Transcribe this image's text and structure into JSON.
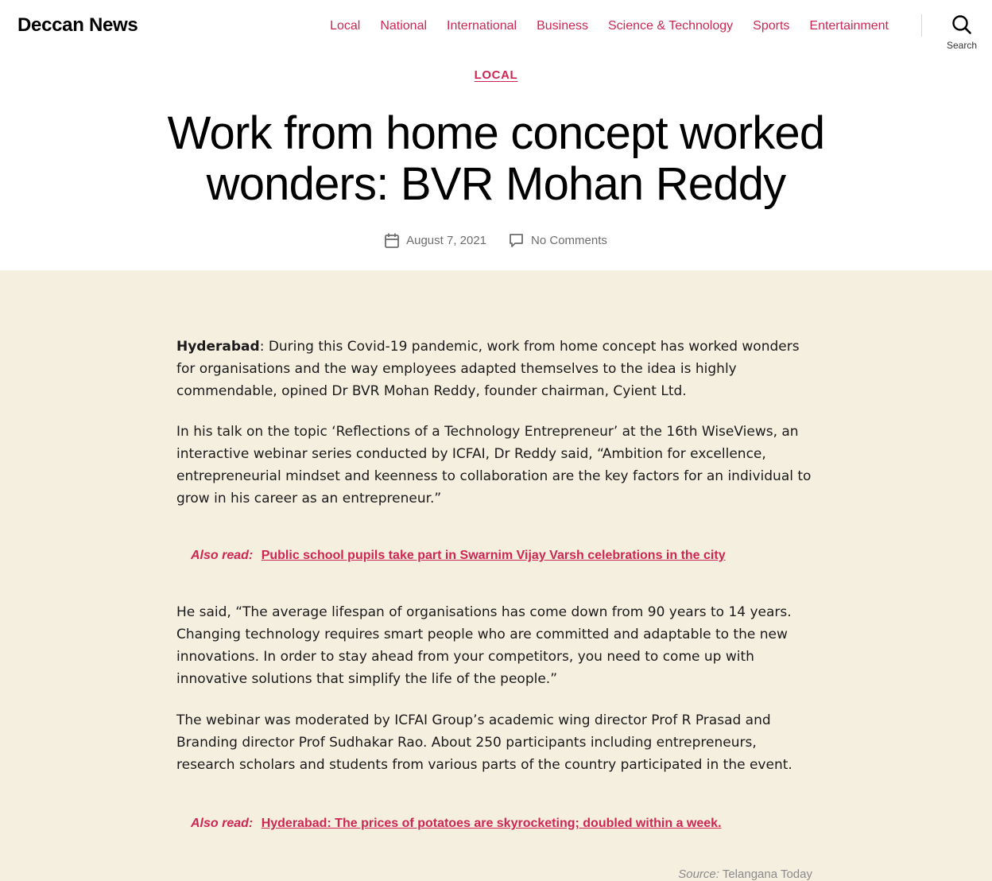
{
  "header": {
    "site_title": "Deccan News",
    "nav": [
      {
        "label": "Local"
      },
      {
        "label": "National"
      },
      {
        "label": "International"
      },
      {
        "label": "Business"
      },
      {
        "label": "Science & Technology"
      },
      {
        "label": "Sports"
      },
      {
        "label": "Entertainment"
      }
    ],
    "search_label": "Search",
    "icon": "search-icon"
  },
  "article": {
    "category": "LOCAL",
    "title": "Work from home concept worked wonders: BVR Mohan Reddy",
    "date": "August 7, 2021",
    "comments": "No Comments",
    "paragraphs": [
      {
        "lead": "Hyderabad",
        "text": ": During this Covid-19 pandemic, work from home concept has worked wonders for organisations and the way employees adapted themselves to the idea is highly commendable, opined Dr BVR Mohan Reddy, founder chairman, Cyient Ltd."
      },
      {
        "text": "In his talk on the topic ‘Reflections of a Technology Entrepreneur’ at the 16th WiseViews, an interactive webinar series conducted by ICFAI, Dr Reddy said, “Ambition for excellence, entrepreneurial mindset and keenness to collaboration are the key factors for an individual to grow in his career as an entrepreneur.”"
      },
      {
        "text": "He said, “The average lifespan of organisations has come down from 90 years to 14 years. Changing technology requires smart people who are committed and adaptable to the new innovations. In order to stay ahead from your competitors, you need to come up with innovative solutions that simplify the life of the people.”"
      },
      {
        "text": "The webinar was moderated by ICFAI Group’s academic wing director Prof R Prasad and Branding director Prof Sudhakar Rao. About 250 participants including entrepreneurs, research scholars and students from various parts of the country participated in the event."
      }
    ],
    "also_read": [
      {
        "label": "Also read:",
        "link": "Public school pupils take part in Swarnim Vijay Varsh celebrations in the city"
      },
      {
        "label": "Also read:",
        "link": "Hyderabad: The prices of potatoes are skyrocketing; doubled within a week."
      }
    ],
    "source": {
      "label": "Source:",
      "value": "Telangana Today"
    }
  },
  "colors": {
    "accent": "#cd2653",
    "content_background": "#f5efe0",
    "meta_text": "#6d6d6d"
  }
}
